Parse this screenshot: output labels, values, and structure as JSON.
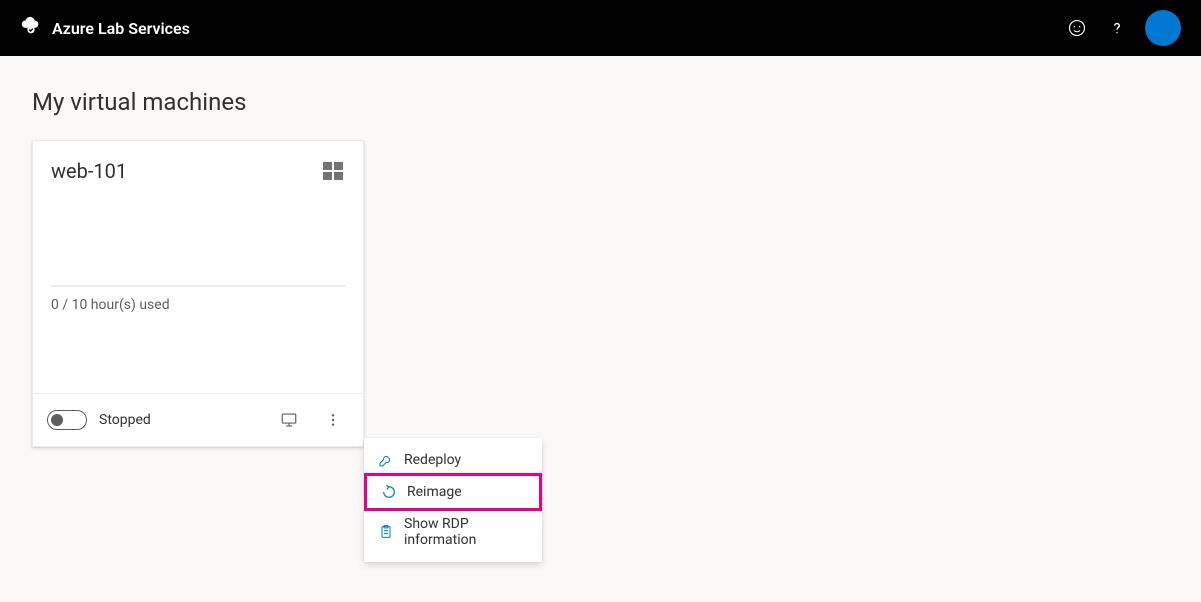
{
  "header": {
    "product": "Azure Lab Services"
  },
  "page": {
    "title": "My virtual machines"
  },
  "vm": {
    "name": "web-101",
    "usage": "0 / 10 hour(s) used",
    "status": "Stopped"
  },
  "menu": {
    "redeploy": "Redeploy",
    "reimage": "Reimage",
    "show_rdp": "Show RDP information"
  }
}
